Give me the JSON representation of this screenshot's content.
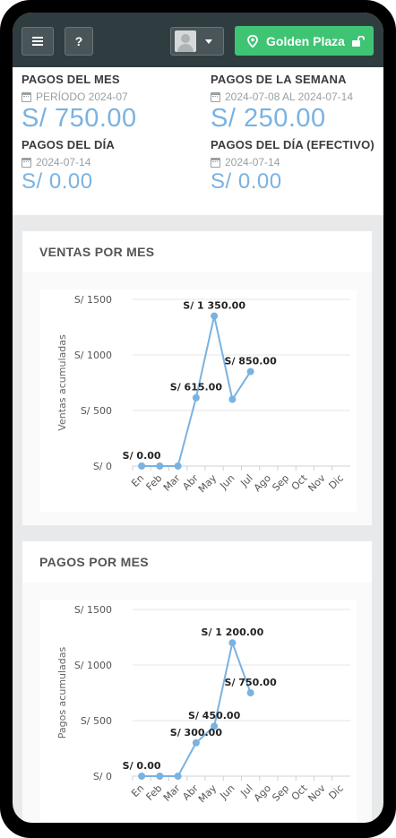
{
  "topbar": {
    "menu_label": "≡",
    "help_label": "?",
    "store_label": "Golden Plaza",
    "icons": [
      "menu-icon",
      "question-icon",
      "avatar-icon",
      "chevron-down-icon",
      "location-pin-icon",
      "unlock-icon"
    ],
    "accent": "#3fc474",
    "bar_color": "#2f3c40"
  },
  "stats": {
    "month": {
      "title": "PAGOS DEL MES",
      "sub": "PERÍODO 2024-07",
      "value": "S/ 750.00"
    },
    "week": {
      "title": "PAGOS DE LA SEMANA",
      "sub": "2024-07-08 AL 2024-07-14",
      "value": "S/ 250.00"
    },
    "day": {
      "title": "PAGOS DEL DÍA",
      "sub": "2024-07-14",
      "value": "S/ 0.00"
    },
    "day_cash": {
      "title": "PAGOS DEL DÍA (EFECTIVO)",
      "sub": "2024-07-14",
      "value": "S/ 0.00"
    }
  },
  "cards": {
    "sales_title": "VENTAS POR MES",
    "payments_title": "PAGOS POR MES"
  },
  "chart_data": [
    {
      "type": "line",
      "title": "",
      "ylabel": "Ventas acumuladas",
      "xlabel": "",
      "categories": [
        "En",
        "Feb",
        "Mar",
        "Abr",
        "May",
        "Jun",
        "Jul",
        "Ago",
        "Sep",
        "Oct",
        "Nov",
        "Dic"
      ],
      "values": [
        0,
        0,
        0,
        615,
        1350,
        600,
        850
      ],
      "data_labels": [
        {
          "index": 0,
          "text": "S/ 0.00"
        },
        {
          "index": 3,
          "text": "S/ 615.00"
        },
        {
          "index": 4,
          "text": "S/ 1 350.00"
        },
        {
          "index": 6,
          "text": "S/ 850.00"
        }
      ],
      "yticks": [
        "S/ 0",
        "S/ 500",
        "S/ 1000",
        "S/ 1500"
      ],
      "ylim": [
        0,
        1500
      ],
      "grid": true,
      "color": "#7ab2e0"
    },
    {
      "type": "line",
      "title": "",
      "ylabel": "Pagos acumuladas",
      "xlabel": "",
      "categories": [
        "En",
        "Feb",
        "Mar",
        "Abr",
        "May",
        "Jun",
        "Jul",
        "Ago",
        "Sep",
        "Oct",
        "Nov",
        "Dic"
      ],
      "values": [
        0,
        0,
        0,
        300,
        450,
        1200,
        750
      ],
      "data_labels": [
        {
          "index": 0,
          "text": "S/ 0.00"
        },
        {
          "index": 3,
          "text": "S/ 300.00"
        },
        {
          "index": 4,
          "text": "S/ 450.00"
        },
        {
          "index": 5,
          "text": "S/ 1 200.00"
        },
        {
          "index": 6,
          "text": "S/ 750.00"
        }
      ],
      "yticks": [
        "S/ 0",
        "S/ 500",
        "S/ 1000",
        "S/ 1500"
      ],
      "ylim": [
        0,
        1500
      ],
      "grid": true,
      "color": "#7ab2e0"
    }
  ]
}
